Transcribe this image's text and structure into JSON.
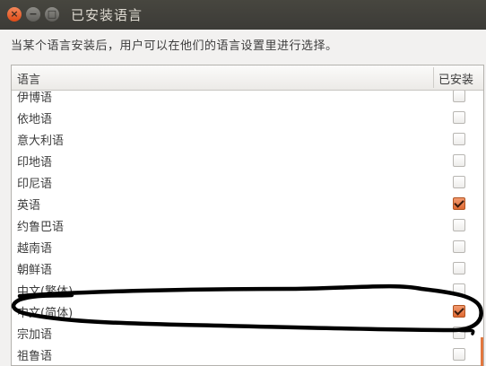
{
  "window": {
    "title": "已安装语言",
    "close_glyph": "×",
    "min_glyph": "−",
    "max_glyph": "□"
  },
  "description": "当某个语言安装后，用户可以在他们的语言设置里进行选择。",
  "table": {
    "col_language": "语言",
    "col_installed": "已安装",
    "rows": [
      {
        "label": "伊博语",
        "installed": false
      },
      {
        "label": "依地语",
        "installed": false
      },
      {
        "label": "意大利语",
        "installed": false
      },
      {
        "label": "印地语",
        "installed": false
      },
      {
        "label": "印尼语",
        "installed": false
      },
      {
        "label": "英语",
        "installed": true
      },
      {
        "label": "约鲁巴语",
        "installed": false
      },
      {
        "label": "越南语",
        "installed": false
      },
      {
        "label": "朝鲜语",
        "installed": false
      },
      {
        "label": "中文(繁体)",
        "installed": false
      },
      {
        "label": "中文(简体)",
        "installed": true
      },
      {
        "label": "宗加语",
        "installed": false
      },
      {
        "label": "祖鲁语",
        "installed": false
      }
    ]
  },
  "colors": {
    "check_accent": "#e06a33",
    "titlebar": "#3c3b37",
    "annotation_stroke": "#000000"
  }
}
